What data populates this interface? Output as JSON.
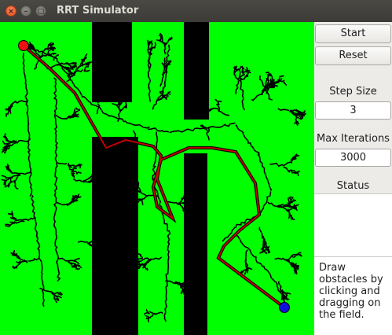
{
  "window": {
    "title": "RRT Simulator",
    "close_glyph": "×",
    "minimize_glyph": "–",
    "maximize_glyph": "□"
  },
  "controls": {
    "start_label": "Start",
    "reset_label": "Reset",
    "step_size_label": "Step Size",
    "step_size_value": "3",
    "max_iterations_label": "Max Iterations",
    "max_iterations_value": "3000",
    "status_label": "Status",
    "status_text": "",
    "help_text": "Draw obstacles by clicking and dragging on the field."
  },
  "colors": {
    "field": "#00ff00",
    "obstacle": "#000000",
    "tree": "#000000",
    "path": "#cc0000",
    "start_node": "#ee1111",
    "goal_node": "#1111dd"
  },
  "icons": {
    "close": "close-icon",
    "minimize": "minimize-icon",
    "maximize": "maximize-icon"
  }
}
